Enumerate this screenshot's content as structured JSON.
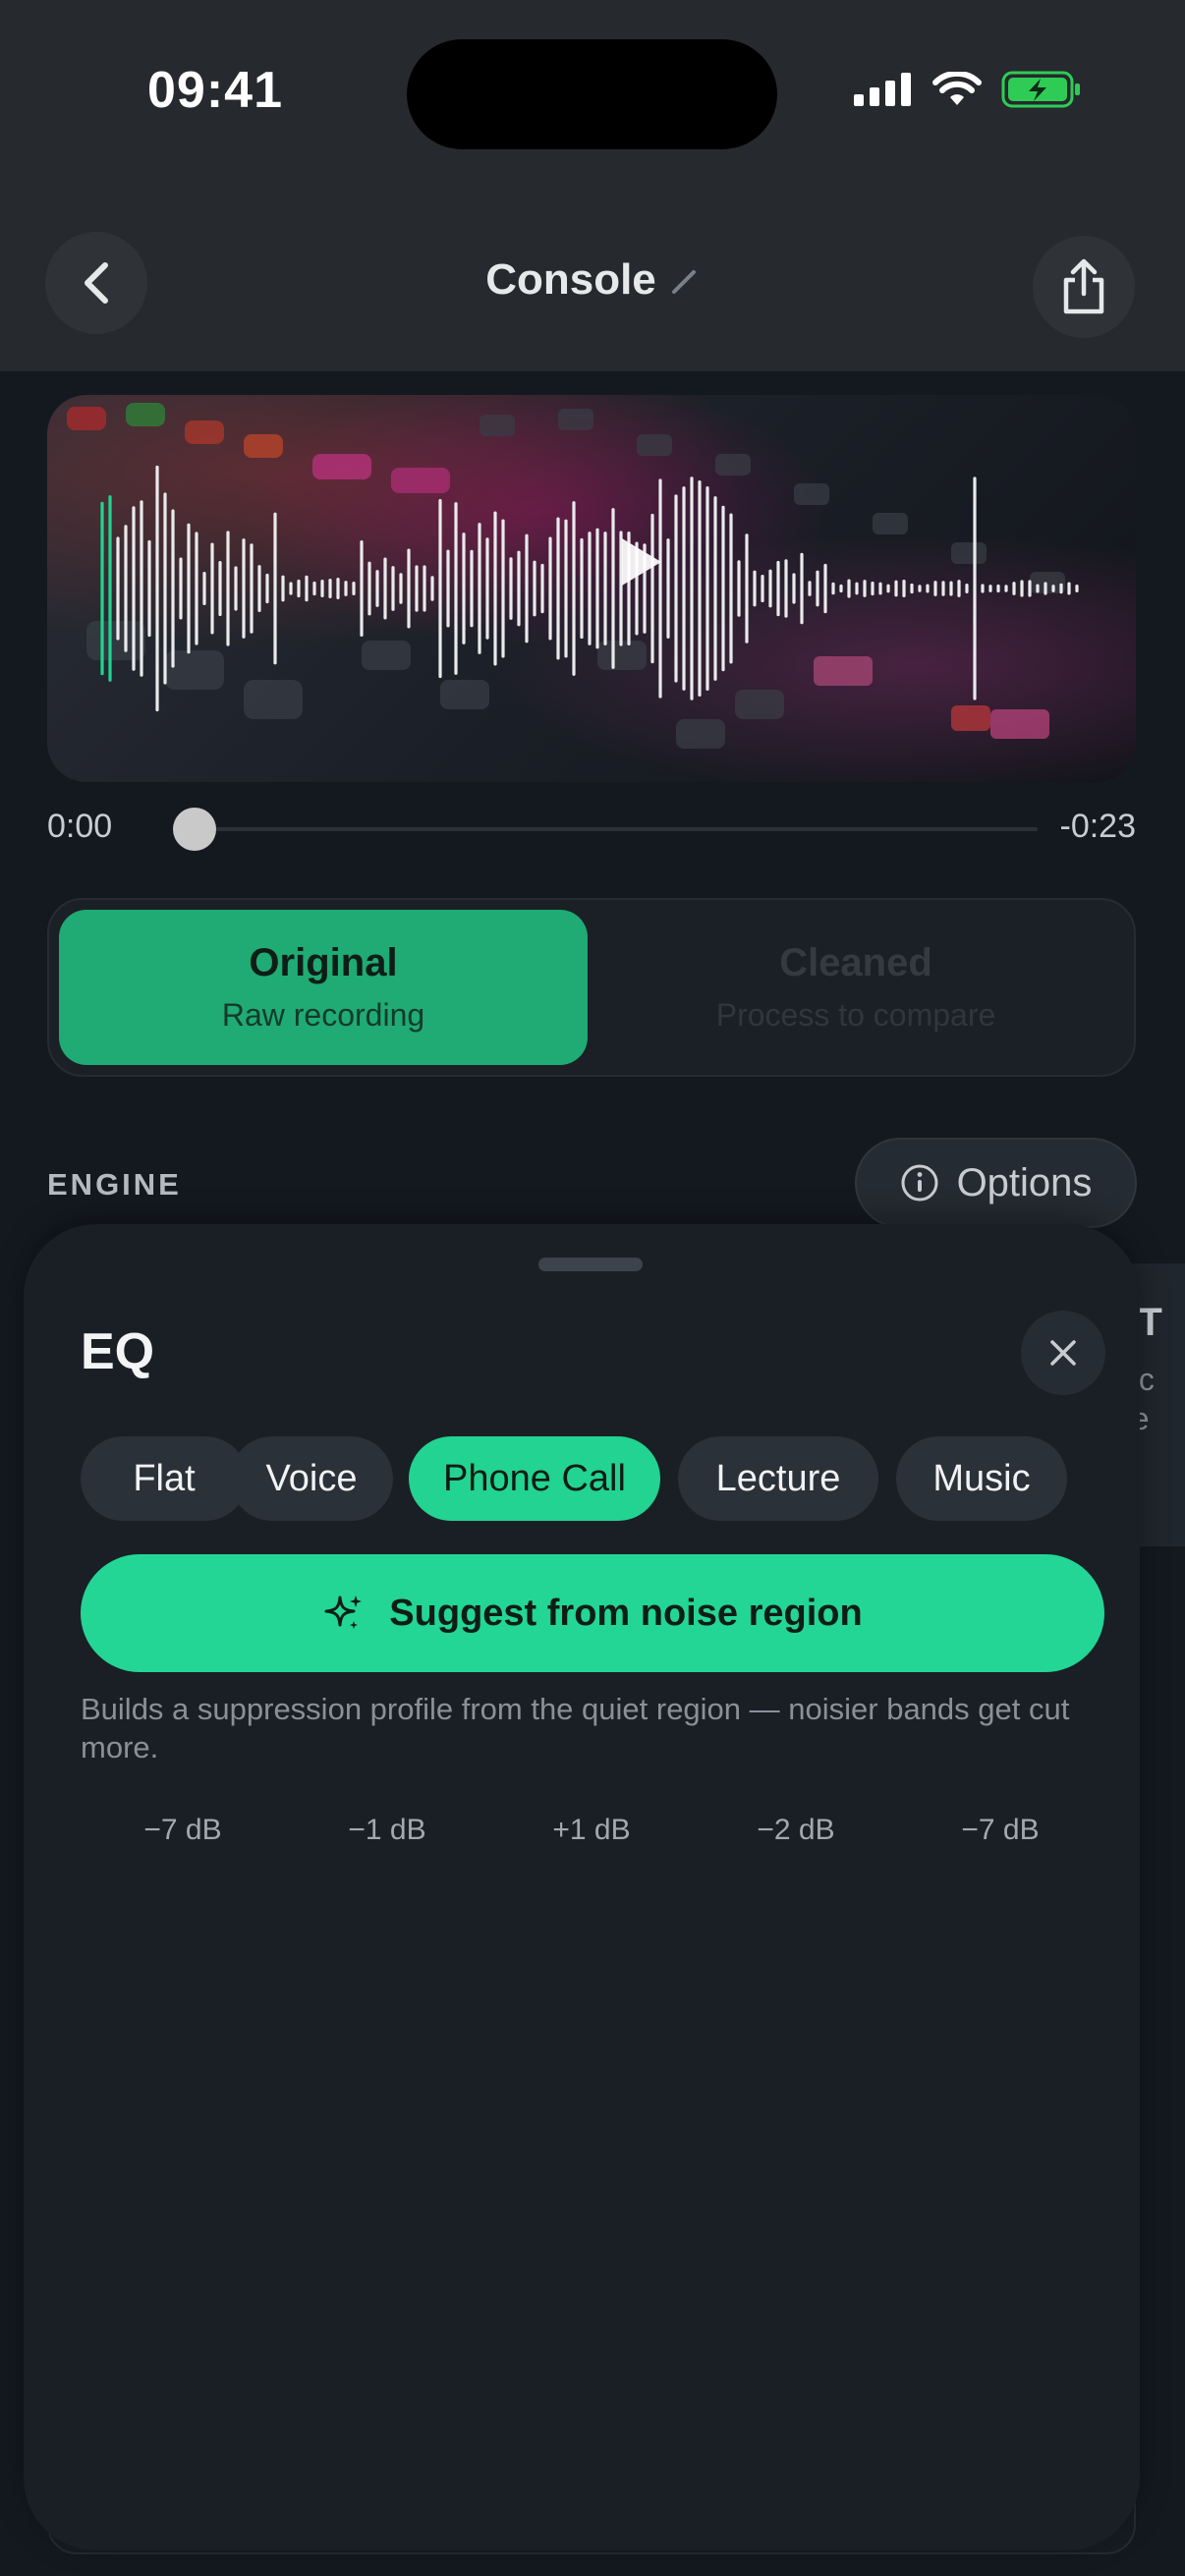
{
  "status_bar": {
    "time": "09:41"
  },
  "nav": {
    "title": "Console",
    "back_icon": "chevron-left-icon",
    "share_icon": "share-icon",
    "edit_icon": "pencil-icon"
  },
  "player": {
    "elapsed": "0:00",
    "remaining": "-0:23",
    "position_fraction": 0.0
  },
  "segment": {
    "original_title": "Original",
    "original_sub": "Raw recording",
    "cleaned_title": "Cleaned",
    "cleaned_sub": "Process to compare",
    "selected": "original"
  },
  "engine": {
    "label": "ENGINE",
    "options_label": "Options"
  },
  "peek": {
    "line1": "nT",
    "line2": "nic",
    "line3": "ee"
  },
  "sheet": {
    "title": "EQ",
    "presets": [
      {
        "label": "Flat",
        "active": false
      },
      {
        "label": "Voice",
        "active": false
      },
      {
        "label": "Phone Call",
        "active": true
      },
      {
        "label": "Lecture",
        "active": false
      },
      {
        "label": "Music",
        "active": false
      }
    ],
    "suggest_label": "Suggest from noise region",
    "hint": "Builds a suppression profile from the quiet region — noisier bands get cut more.",
    "bands": [
      {
        "label": "−7 dB",
        "gain": -7
      },
      {
        "label": "−1 dB",
        "gain": -1
      },
      {
        "label": "+1 dB",
        "gain": 1
      },
      {
        "label": "−2 dB",
        "gain": -2
      },
      {
        "label": "−7 dB",
        "gain": -7
      }
    ]
  },
  "colors": {
    "accent": "#22d391",
    "segment_active": "#1fab73",
    "background": "#141920"
  }
}
